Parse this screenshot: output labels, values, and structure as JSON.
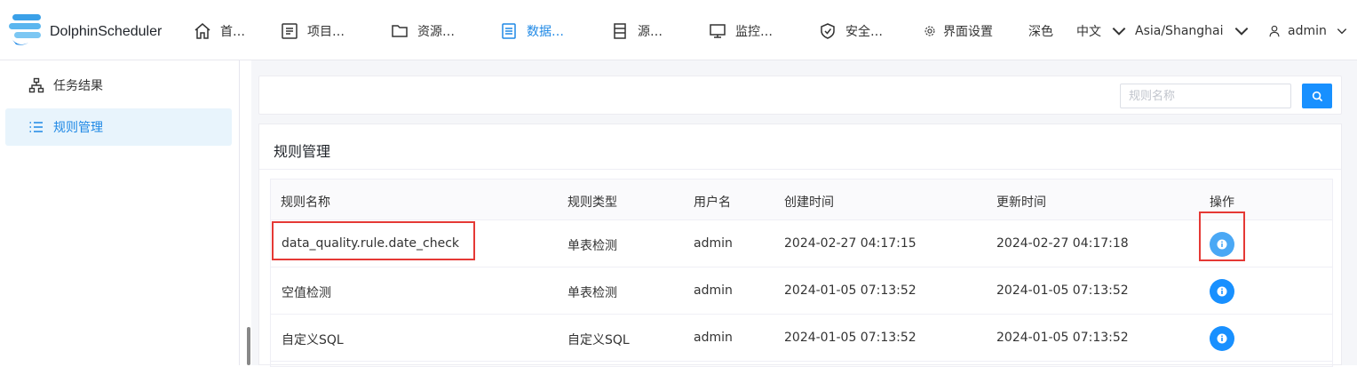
{
  "app": {
    "name": "DolphinScheduler"
  },
  "nav": {
    "items": [
      {
        "label": "首…",
        "icon": "home-icon"
      },
      {
        "label": "项目…",
        "icon": "project-icon"
      },
      {
        "label": "资源…",
        "icon": "folder-icon"
      },
      {
        "label": "数据…",
        "icon": "data-quality-icon",
        "active": true
      },
      {
        "label": "源…",
        "icon": "datasource-icon"
      },
      {
        "label": "监控…",
        "icon": "monitor-icon"
      },
      {
        "label": "安全…",
        "icon": "shield-icon"
      }
    ],
    "ui_settings": "界面设置",
    "theme": "深色",
    "language": "中文",
    "timezone": "Asia/Shanghai",
    "user": "admin"
  },
  "sidebar": {
    "items": [
      {
        "label": "任务结果",
        "icon": "sitemap-icon"
      },
      {
        "label": "规则管理",
        "icon": "list-icon",
        "active": true
      }
    ]
  },
  "search": {
    "placeholder": "规则名称"
  },
  "table": {
    "title": "规则管理",
    "headers": [
      "规则名称",
      "规则类型",
      "用户名",
      "创建时间",
      "更新时间",
      "操作"
    ],
    "rows": [
      {
        "name": "data_quality.rule.date_check",
        "type": "单表检测",
        "user": "admin",
        "created": "2024-02-27 04:17:15",
        "updated": "2024-02-27 04:17:18"
      },
      {
        "name": "空值检测",
        "type": "单表检测",
        "user": "admin",
        "created": "2024-01-05 07:13:52",
        "updated": "2024-01-05 07:13:52"
      },
      {
        "name": "自定义SQL",
        "type": "自定义SQL",
        "user": "admin",
        "created": "2024-01-05 07:13:52",
        "updated": "2024-01-05 07:13:52"
      }
    ]
  },
  "colors": {
    "accent": "#1890ff",
    "highlight": "#e53935"
  }
}
